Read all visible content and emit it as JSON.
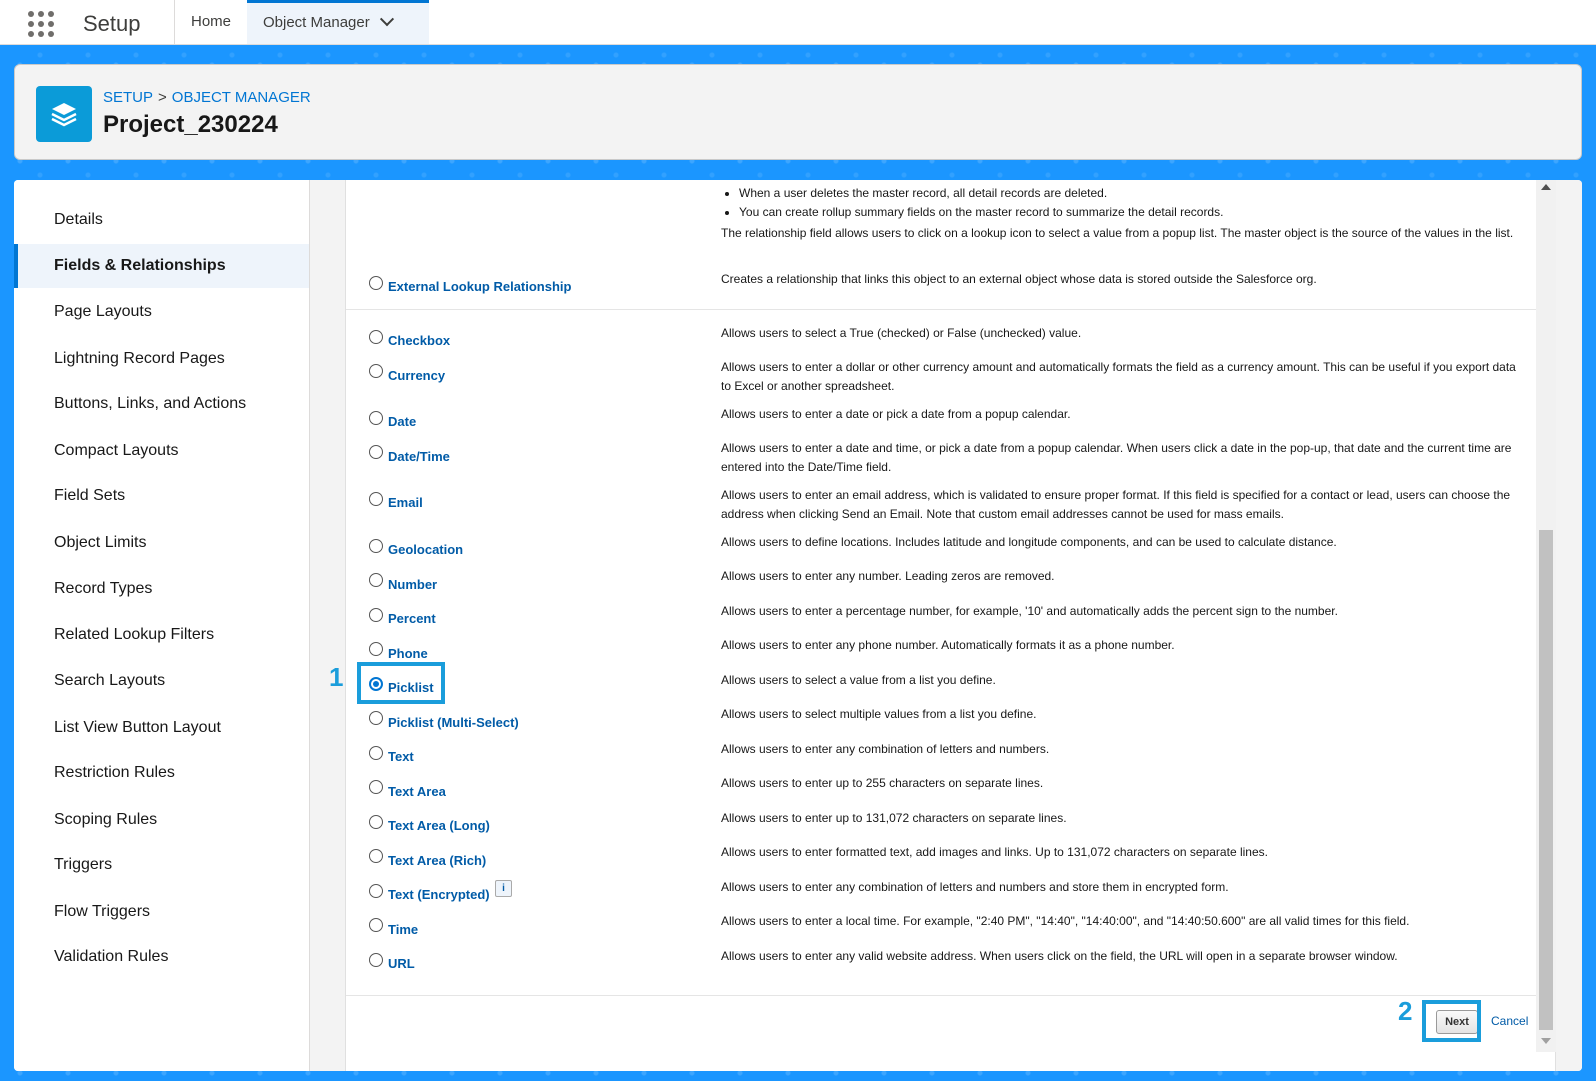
{
  "topbar": {
    "app_name": "Setup",
    "tabs": [
      {
        "label": "Home"
      },
      {
        "label": "Object Manager"
      }
    ]
  },
  "header": {
    "breadcrumb_setup": "SETUP",
    "breadcrumb_sep": ">",
    "breadcrumb_om": "OBJECT MANAGER",
    "title": "Project_230224"
  },
  "sidebar": {
    "items": [
      {
        "label": "Details"
      },
      {
        "label": "Fields & Relationships"
      },
      {
        "label": "Page Layouts"
      },
      {
        "label": "Lightning Record Pages"
      },
      {
        "label": "Buttons, Links, and Actions"
      },
      {
        "label": "Compact Layouts"
      },
      {
        "label": "Field Sets"
      },
      {
        "label": "Object Limits"
      },
      {
        "label": "Record Types"
      },
      {
        "label": "Related Lookup Filters"
      },
      {
        "label": "Search Layouts"
      },
      {
        "label": "List View Button Layout"
      },
      {
        "label": "Restriction Rules"
      },
      {
        "label": "Scoping Rules"
      },
      {
        "label": "Triggers"
      },
      {
        "label": "Flow Triggers"
      },
      {
        "label": "Validation Rules"
      }
    ],
    "active": "Fields & Relationships"
  },
  "content": {
    "top_bullets": [
      "When a user deletes the master record, all detail records are deleted.",
      "You can create rollup summary fields on the master record to summarize the detail records."
    ],
    "top_note": "The relationship field allows users to click on a lookup icon to select a value from a popup list. The master object is the source of the values in the list.",
    "external_lookup": {
      "label": "External Lookup Relationship",
      "desc": "Creates a relationship that links this object to an external object whose data is stored outside the Salesforce org."
    },
    "field_types": [
      {
        "label": "Checkbox",
        "desc": "Allows users to select a True (checked) or False (unchecked) value."
      },
      {
        "label": "Currency",
        "desc": "Allows users to enter a dollar or other currency amount and automatically formats the field as a currency amount. This can be useful if you export data to Excel or another spreadsheet."
      },
      {
        "label": "Date",
        "desc": "Allows users to enter a date or pick a date from a popup calendar."
      },
      {
        "label": "Date/Time",
        "desc": "Allows users to enter a date and time, or pick a date from a popup calendar. When users click a date in the pop-up, that date and the current time are entered into the Date/Time field."
      },
      {
        "label": "Email",
        "desc": "Allows users to enter an email address, which is validated to ensure proper format. If this field is specified for a contact or lead, users can choose the address when clicking Send an Email. Note that custom email addresses cannot be used for mass emails."
      },
      {
        "label": "Geolocation",
        "desc": "Allows users to define locations. Includes latitude and longitude components, and can be used to calculate distance."
      },
      {
        "label": "Number",
        "desc": "Allows users to enter any number. Leading zeros are removed."
      },
      {
        "label": "Percent",
        "desc": "Allows users to enter a percentage number, for example, '10' and automatically adds the percent sign to the number."
      },
      {
        "label": "Phone",
        "desc": "Allows users to enter any phone number. Automatically formats it as a phone number."
      },
      {
        "label": "Picklist",
        "desc": "Allows users to select a value from a list you define."
      },
      {
        "label": "Picklist (Multi-Select)",
        "desc": "Allows users to select multiple values from a list you define."
      },
      {
        "label": "Text",
        "desc": "Allows users to enter any combination of letters and numbers."
      },
      {
        "label": "Text Area",
        "desc": "Allows users to enter up to 255 characters on separate lines."
      },
      {
        "label": "Text Area (Long)",
        "desc": "Allows users to enter up to 131,072 characters on separate lines."
      },
      {
        "label": "Text Area (Rich)",
        "desc": "Allows users to enter formatted text, add images and links. Up to 131,072 characters on separate lines."
      },
      {
        "label": "Text (Encrypted)",
        "desc": "Allows users to enter any combination of letters and numbers and store them in encrypted form."
      },
      {
        "label": "Time",
        "desc": "Allows users to enter a local time. For example, \"2:40 PM\", \"14:40\", \"14:40:00\", and \"14:40:50.600\" are all valid times for this field."
      },
      {
        "label": "URL",
        "desc": "Allows users to enter any valid website address. When users click on the field, the URL will open in a separate browser window."
      }
    ],
    "selected": "Picklist",
    "info_icon_glyph": "i"
  },
  "buttons": {
    "next": "Next",
    "cancel": "Cancel"
  },
  "annotations": {
    "step1": "1",
    "step2": "2"
  },
  "colors": {
    "brand_blue": "#1b96ff",
    "link_blue": "#015ba7",
    "highlight": "#1a9ddb"
  }
}
